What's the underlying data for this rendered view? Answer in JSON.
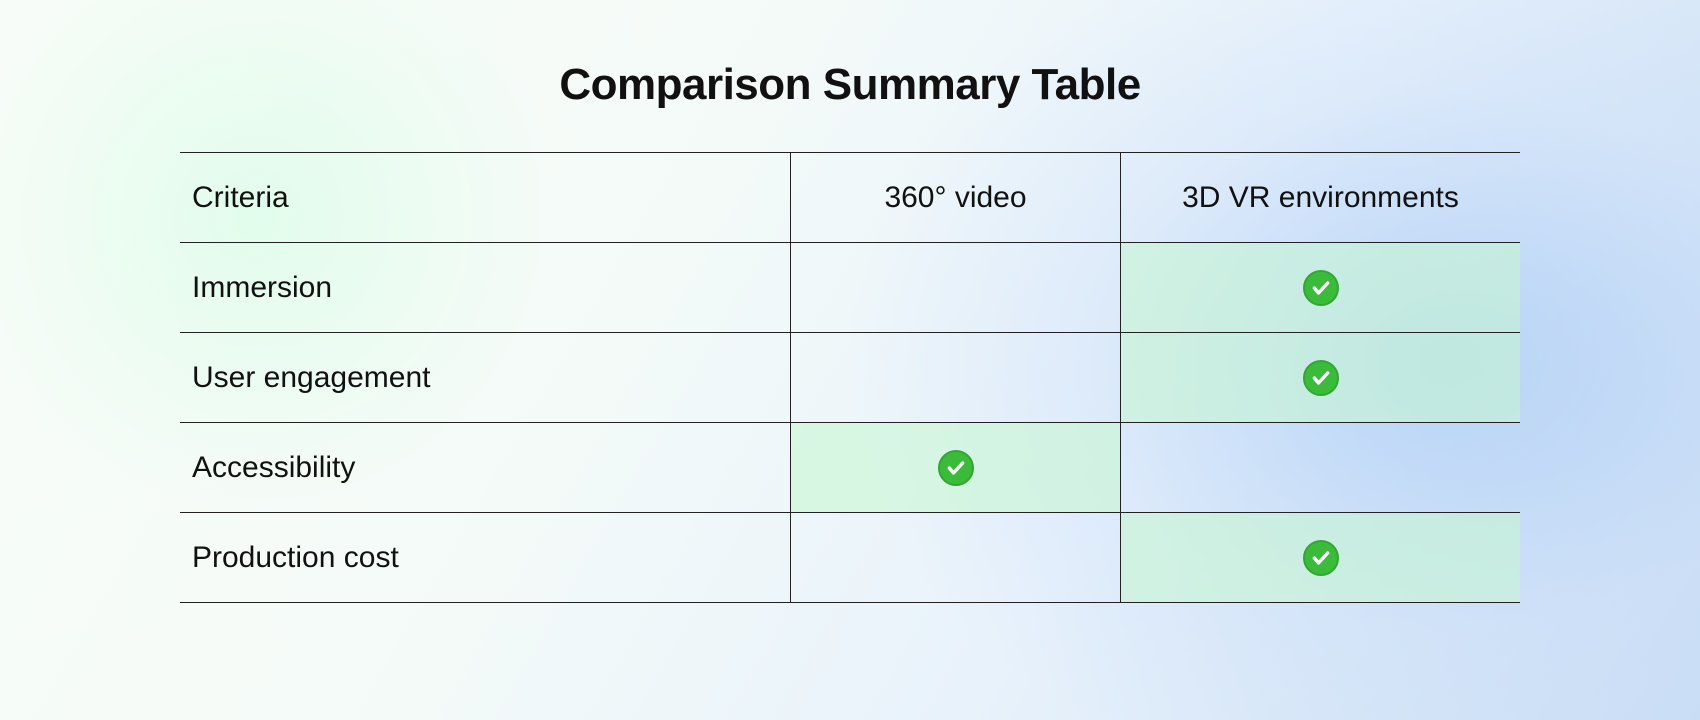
{
  "title": "Comparison Summary Table",
  "headers": {
    "criteria": "Criteria",
    "col1": "360° video",
    "col2": "3D VR environments"
  },
  "rows": [
    {
      "label": "Immersion",
      "col1_checked": false,
      "col2_checked": true
    },
    {
      "label": "User engagement",
      "col1_checked": false,
      "col2_checked": true
    },
    {
      "label": "Accessibility",
      "col1_checked": true,
      "col2_checked": false
    },
    {
      "label": "Production cost",
      "col1_checked": false,
      "col2_checked": true
    }
  ],
  "chart_data": {
    "type": "table",
    "title": "Comparison Summary Table",
    "columns": [
      "Criteria",
      "360° video",
      "3D VR environments"
    ],
    "data": [
      [
        "Immersion",
        false,
        true
      ],
      [
        "User engagement",
        false,
        true
      ],
      [
        "Accessibility",
        true,
        false
      ],
      [
        "Production cost",
        false,
        true
      ]
    ]
  }
}
